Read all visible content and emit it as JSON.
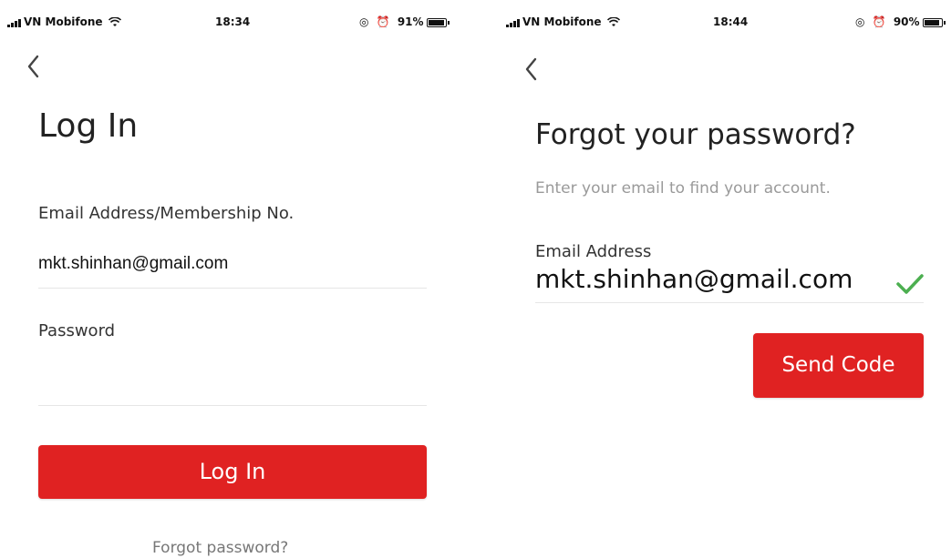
{
  "login_screen": {
    "status_bar": {
      "carrier": "VN Mobifone",
      "time": "18:34",
      "battery": "91%",
      "battery_level": 0.91
    },
    "back_icon": "chevron-left-icon",
    "title": "Log In",
    "email_label": "Email Address/Membership No.",
    "email_value": "mkt.shinhan@gmail.com",
    "password_label": "Password",
    "password_value": "",
    "login_button": "Log In",
    "forgot_link": "Forgot password?"
  },
  "forgot_screen": {
    "status_bar": {
      "carrier": "VN Mobifone",
      "time": "18:44",
      "battery": "90%",
      "battery_level": 0.9
    },
    "back_icon": "chevron-left-icon",
    "title": "Forgot your password?",
    "subtitle": "Enter your email to find your account.",
    "email_label": "Email Address",
    "email_value": "mkt.shinhan@gmail.com",
    "valid_icon": "check-icon",
    "send_button": "Send Code"
  },
  "colors": {
    "accent": "#e02222",
    "check": "#4caf50",
    "divider": "#e6e6e6"
  }
}
